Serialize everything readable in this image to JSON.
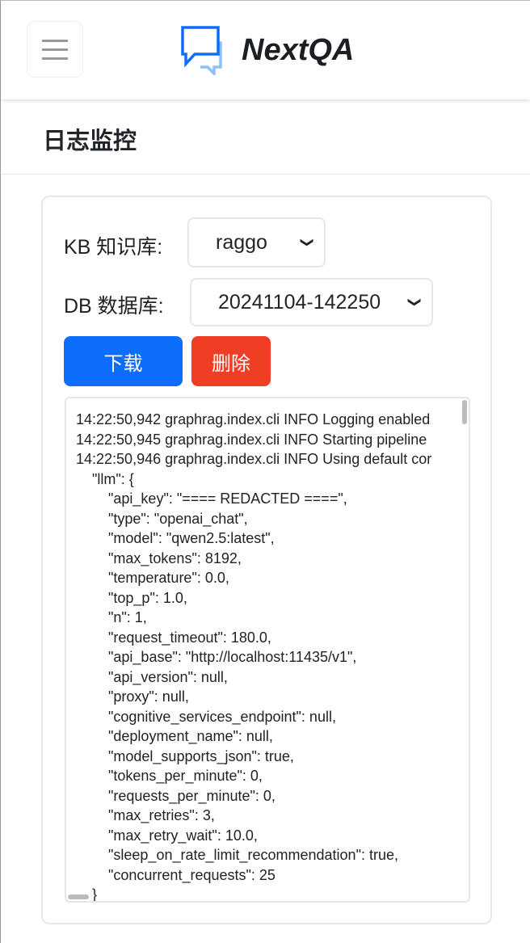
{
  "header": {
    "brand": "NextQA",
    "menu_icon": "hamburger-icon",
    "logo_icon": "chat-bubbles-icon"
  },
  "page": {
    "title": "日志监控"
  },
  "form": {
    "kb_label": "KB 知识库:",
    "kb_value": "raggo",
    "db_label": "DB 数据库:",
    "db_value": "20241104-142250",
    "download_label": "下载",
    "delete_label": "删除"
  },
  "colors": {
    "primary": "#0d6efd",
    "danger": "#f03e24"
  },
  "log": {
    "lines": [
      "14:22:50,942 graphrag.index.cli INFO Logging enabled",
      "14:22:50,945 graphrag.index.cli INFO Starting pipeline",
      "14:22:50,946 graphrag.index.cli INFO Using default cor",
      "    \"llm\": {",
      "        \"api_key\": \"==== REDACTED ====\",",
      "        \"type\": \"openai_chat\",",
      "        \"model\": \"qwen2.5:latest\",",
      "        \"max_tokens\": 8192,",
      "        \"temperature\": 0.0,",
      "        \"top_p\": 1.0,",
      "        \"n\": 1,",
      "        \"request_timeout\": 180.0,",
      "        \"api_base\": \"http://localhost:11435/v1\",",
      "        \"api_version\": null,",
      "        \"proxy\": null,",
      "        \"cognitive_services_endpoint\": null,",
      "        \"deployment_name\": null,",
      "        \"model_supports_json\": true,",
      "        \"tokens_per_minute\": 0,",
      "        \"requests_per_minute\": 0,",
      "        \"max_retries\": 3,",
      "        \"max_retry_wait\": 10.0,",
      "        \"sleep_on_rate_limit_recommendation\": true,",
      "        \"concurrent_requests\": 25",
      "    }"
    ]
  }
}
